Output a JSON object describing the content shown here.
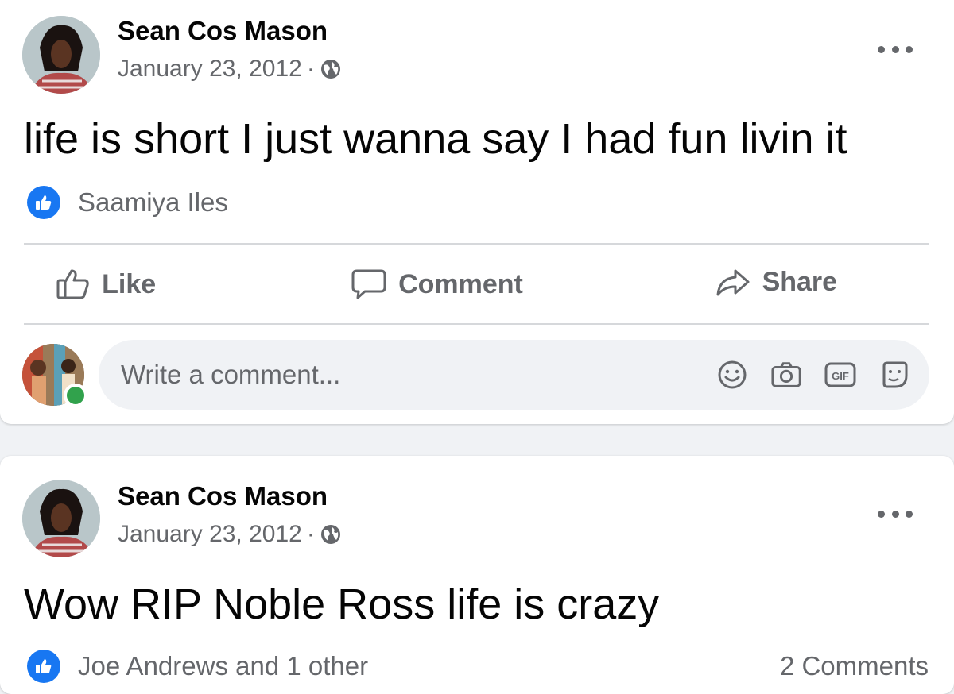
{
  "posts": [
    {
      "author": "Sean Cos Mason",
      "date": "January 23, 2012",
      "separator": "·",
      "text": "life is short I just wanna say I had fun livin it",
      "reactions": {
        "names": "Saamiya Iles",
        "comments": ""
      },
      "actions": {
        "like": "Like",
        "comment": "Comment",
        "share": "Share"
      },
      "comment_placeholder": "Write a comment..."
    },
    {
      "author": "Sean Cos Mason",
      "date": "January 23, 2012",
      "separator": "·",
      "text": "Wow RIP Noble Ross life is crazy",
      "reactions": {
        "names": "Joe Andrews and 1 other",
        "comments": "2 Comments"
      }
    }
  ],
  "icons": {
    "privacy": "globe-icon",
    "more": "more-options-icon",
    "like_badge": "thumbs-up-icon",
    "emoji": "emoji-icon",
    "camera": "camera-icon",
    "gif": "gif-icon",
    "sticker": "sticker-icon"
  },
  "colors": {
    "brand": "#1877f2",
    "online": "#31a24c",
    "secondary_text": "#65676b"
  }
}
